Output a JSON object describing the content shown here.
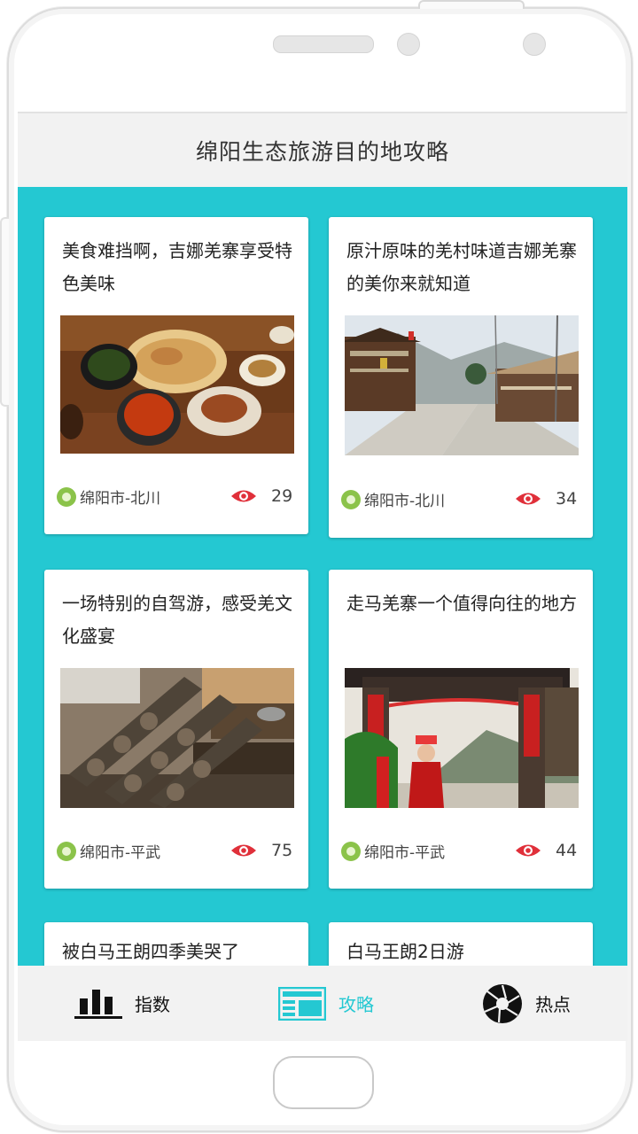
{
  "header": {
    "title": "绵阳生态旅游目的地攻略"
  },
  "cards": [
    {
      "title": "美食难挡啊，吉娜羌寨享受特色美味",
      "location": "绵阳市-北川",
      "views": "29",
      "image": "food-dishes"
    },
    {
      "title": "原汁原味的羌村味道吉娜羌寨的美你来就知道",
      "location": "绵阳市-北川",
      "views": "34",
      "image": "village-street"
    },
    {
      "title": "一场特别的自驾游，感受羌文化盛宴",
      "location": "绵阳市-平武",
      "views": "75",
      "image": "carved-wood"
    },
    {
      "title": "走马羌寨一个值得向往的地方",
      "location": "绵阳市-平武",
      "views": "44",
      "image": "village-gate"
    },
    {
      "title": "被白马王朗四季美哭了"
    },
    {
      "title": "白马王朗2日游"
    }
  ],
  "tabs": [
    {
      "label": "指数",
      "icon": "bar-chart-icon",
      "color": "#111111"
    },
    {
      "label": "攻略",
      "icon": "newspaper-icon",
      "color": "#24c8d2",
      "active": true
    },
    {
      "label": "热点",
      "icon": "aperture-icon",
      "color": "#111111"
    }
  ],
  "colors": {
    "accent": "#24c8d2",
    "pin": "#8bc34a",
    "eye": "#e0303a"
  }
}
